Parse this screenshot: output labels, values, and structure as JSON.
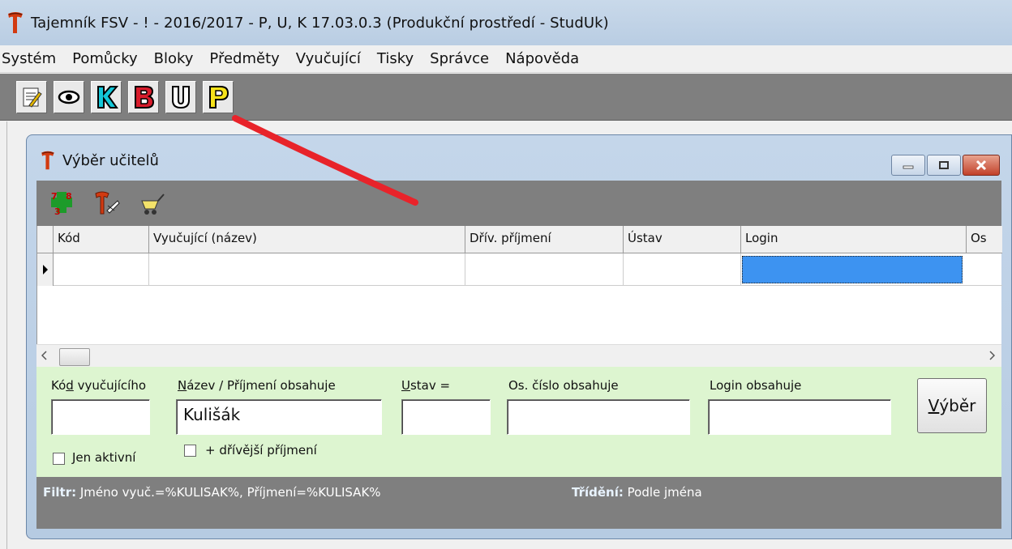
{
  "window": {
    "title": "Tajemník FSV - ! - 2016/2017 - P, U, K   17.03.0.3   (Produkční prostředí - StudUk)"
  },
  "menu": [
    "Systém",
    "Pomůcky",
    "Bloky",
    "Předměty",
    "Vyučující",
    "Tisky",
    "Správce",
    "Nápověda"
  ],
  "toolbar": {
    "buttons": [
      {
        "icon": "edit-note-icon"
      },
      {
        "icon": "eye-icon"
      },
      {
        "icon": "letter-k-icon",
        "letter": "K",
        "color": "#13c7d8"
      },
      {
        "icon": "letter-b-icon",
        "letter": "B",
        "color": "#d81b2b"
      },
      {
        "icon": "letter-u-icon",
        "letter": "U",
        "color": "#ffffff"
      },
      {
        "icon": "letter-p-icon",
        "letter": "P",
        "color": "#f6e21a"
      }
    ]
  },
  "child": {
    "title": "Výběr učitelů",
    "grid": {
      "columns": [
        "Kód",
        "Vyučující (název)",
        "Dřív. příjmení",
        "Ústav",
        "Login",
        "Os"
      ]
    },
    "filter": {
      "kod_label_a": "Kó",
      "kod_label_u": "d",
      "kod_label_b": " vyučujícího",
      "kod_value": "",
      "nazev_label_u": "N",
      "nazev_label_b": "ázev / Příjmení obsahuje",
      "nazev_value": "Kulišák",
      "ustav_label_u": "U",
      "ustav_label_b": "stav =",
      "ustav_value": "",
      "oscislo_label": "Os. číslo obsahuje",
      "oscislo_value": "",
      "login_label": "Login obsahuje",
      "login_value": "",
      "jen_aktivni": "Jen aktivní",
      "drivejsi": "+ dřívější příjmení",
      "vyber_u": "V",
      "vyber_b": "ýběr"
    },
    "status": {
      "filtr_label": "Filtr:",
      "filtr_value": " Jméno vyuč.=%KULISAK%, Příjmení=%KULISAK%",
      "trideni_label": "Třídění:",
      "trideni_value": " Podle jména"
    }
  },
  "colors": {
    "accent_select": "#3d93f1",
    "filter_bg": "#ddf5d0",
    "toolbar_bg": "#7f7f7f",
    "annotation": "#e8232a"
  }
}
